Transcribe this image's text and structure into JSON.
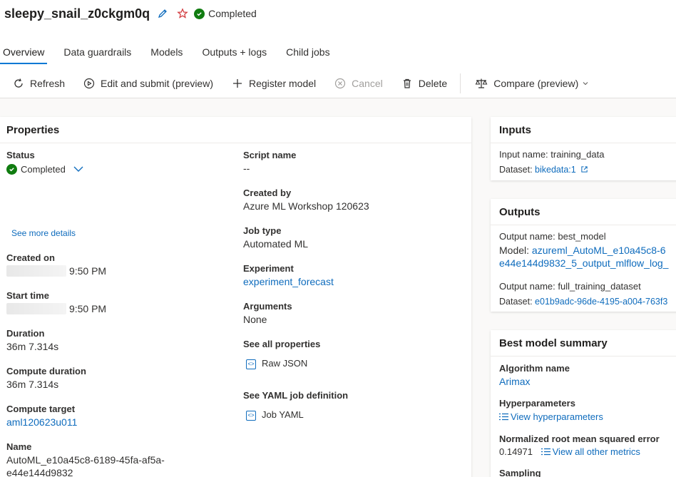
{
  "job": {
    "title": "sleepy_snail_z0ckgm0q",
    "status": "Completed"
  },
  "tabs": [
    "Overview",
    "Data guardrails",
    "Models",
    "Outputs + logs",
    "Child jobs"
  ],
  "toolbar": {
    "refresh": "Refresh",
    "edit_submit": "Edit and submit (preview)",
    "register_model": "Register model",
    "cancel": "Cancel",
    "delete": "Delete",
    "compare": "Compare (preview)"
  },
  "properties": {
    "heading": "Properties",
    "status_label": "Status",
    "status_value": "Completed",
    "see_more": "See more details",
    "created_on_label": "Created on",
    "created_on_value": "9:50 PM",
    "start_time_label": "Start time",
    "start_time_value": "9:50 PM",
    "duration_label": "Duration",
    "duration_value": "36m 7.314s",
    "compute_duration_label": "Compute duration",
    "compute_duration_value": "36m 7.314s",
    "compute_target_label": "Compute target",
    "compute_target_value": "aml120623u011",
    "name_label": "Name",
    "name_value_1": "AutoML_e10a45c8-6189-45fa-af5a-",
    "name_value_2": "e44e144d9832",
    "script_name_label": "Script name",
    "script_name_value": "--",
    "created_by_label": "Created by",
    "created_by_value": "Azure ML Workshop 120623",
    "job_type_label": "Job type",
    "job_type_value": "Automated ML",
    "experiment_label": "Experiment",
    "experiment_value": "experiment_forecast",
    "arguments_label": "Arguments",
    "arguments_value": "None",
    "see_all_label": "See all properties",
    "raw_json": "Raw JSON",
    "yaml_label": "See YAML job definition",
    "job_yaml": "Job YAML"
  },
  "inputs": {
    "heading": "Inputs",
    "input_name": "Input name: training_data",
    "dataset_label": "Dataset:",
    "dataset_value": "bikedata:1"
  },
  "outputs": {
    "heading": "Outputs",
    "output1_name": "Output name: best_model",
    "model_label": "Model:",
    "model_value_1": "azureml_AutoML_e10a45c8-6",
    "model_value_2": "e44e144d9832_5_output_mlflow_log_",
    "output2_name": "Output name: full_training_dataset",
    "dataset2_label": "Dataset:",
    "dataset2_value": "e01b9adc-96de-4195-a004-763f3"
  },
  "best_model": {
    "heading": "Best model summary",
    "algorithm_label": "Algorithm name",
    "algorithm_value": "Arimax",
    "hyper_label": "Hyperparameters",
    "hyper_link": "View hyperparameters",
    "nrmse_label": "Normalized root mean squared error",
    "nrmse_value": "0.14971",
    "metrics_link": "View all other metrics",
    "sampling_label": "Sampling"
  },
  "colors": {
    "accent": "#0078d4",
    "link": "#0f6cbd",
    "success": "#107c10"
  }
}
